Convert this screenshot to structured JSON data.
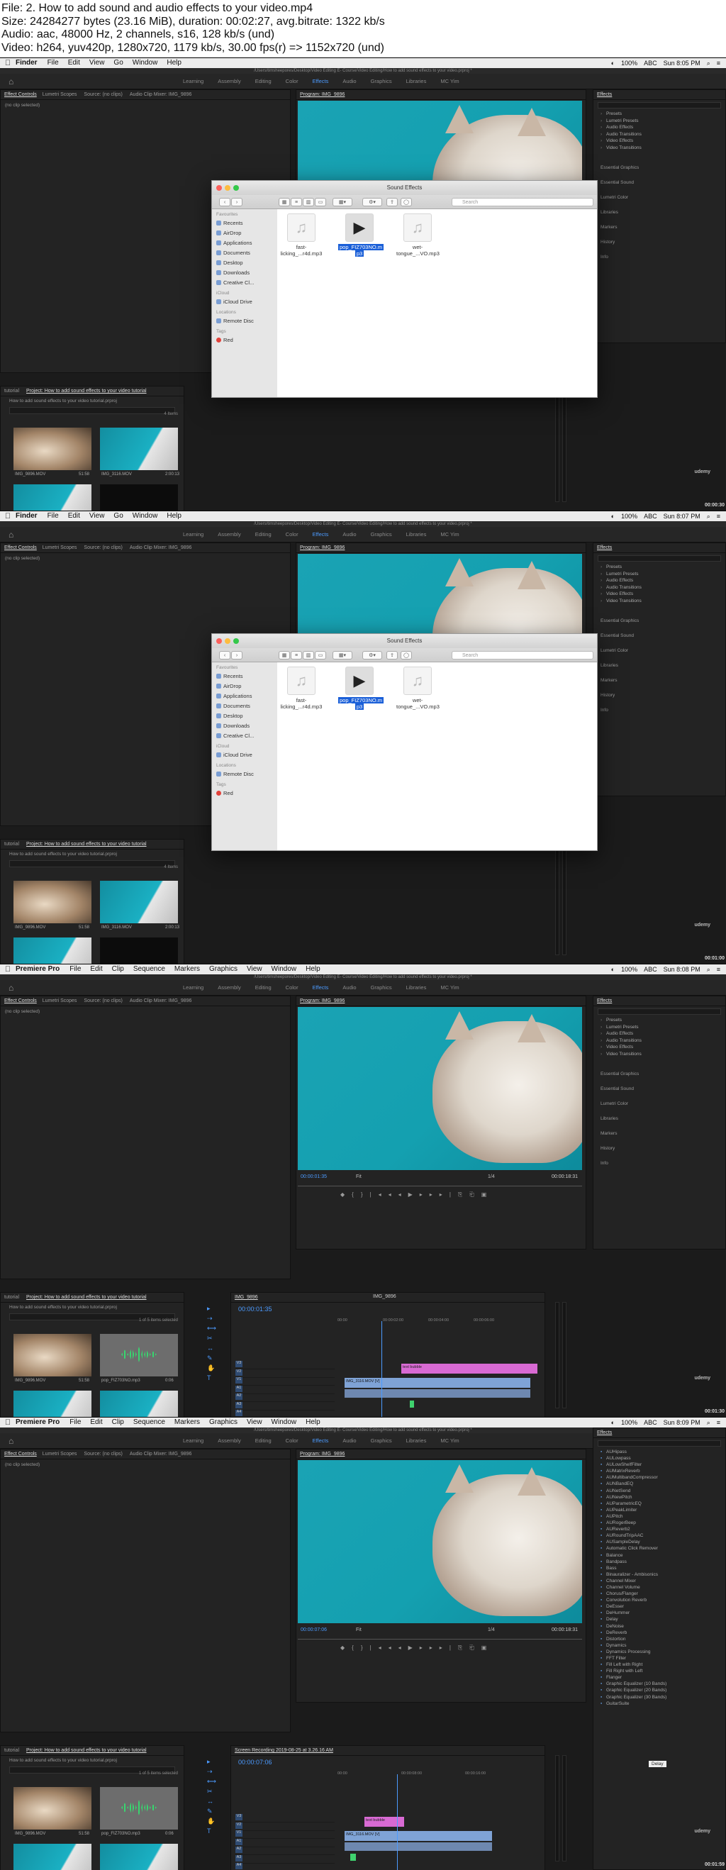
{
  "info": {
    "line1": "File: 2. How to add sound and audio effects to your video.mp4",
    "line2": "Size: 24284277 bytes (23.16 MiB), duration: 00:02:27, avg.bitrate: 1322 kb/s",
    "line3": "Audio: aac, 48000 Hz, 2 channels, s16, 128 kb/s (und)",
    "line4": "Video: h264, yuv420p, 1280x720, 1179 kb/s, 30.00 fps(r) => 1152x720 (und)"
  },
  "path": "/Users/timsheepores/Desktop/Video Editing E- Course/Video Editing/How to add sound effects to your video.prproj *",
  "workspace_tabs": [
    "Learning",
    "Assembly",
    "Editing",
    "Color",
    "Effects",
    "Audio",
    "Graphics",
    "Libraries",
    "MC Yim"
  ],
  "active_tab": "Effects",
  "menubar": {
    "finder_app": "Finder",
    "finder_items": [
      "File",
      "Edit",
      "View",
      "Go",
      "Window",
      "Help"
    ],
    "premiere_app": "Premiere Pro",
    "premiere_items": [
      "File",
      "Edit",
      "Clip",
      "Sequence",
      "Markers",
      "Graphics",
      "View",
      "Window",
      "Help"
    ],
    "status": "100%",
    "abc": "ABC",
    "times": [
      "Sun 8:05 PM",
      "Sun 8:07 PM",
      "Sun 8:08 PM",
      "Sun 8:09 PM"
    ]
  },
  "panels": {
    "effect_controls": "Effect Controls",
    "lumetri_scopes": "Lumetri Scopes",
    "source": "Source: (no clips)",
    "audio_mixer": "Audio Clip Mixer: IMG_9896",
    "no_clip": "(no clip selected)",
    "program": "Program: IMG_9896",
    "effects": "Effects",
    "project_tutorial": "tutorial",
    "project": "Project: How to add sound effects to your video tutorial",
    "project_file": "How to add sound effects to your video tutorial.prproj",
    "items_count": "4 Items",
    "selected_count": "1 of 5 items selected",
    "timeline_tab": "IMG_9896",
    "screen_rec": "Screen Recording 2019-08-25 at 3.26.16 AM"
  },
  "effects_tree": [
    "Presets",
    "Lumetri Presets",
    "Audio Effects",
    "Audio Transitions",
    "Video Effects",
    "Video Transitions"
  ],
  "effects_sections": [
    "Essential Graphics",
    "Essential Sound",
    "Lumetri Color",
    "Libraries",
    "Markers",
    "History",
    "Info"
  ],
  "audio_effects_list": [
    "AUHipass",
    "AULowpass",
    "AULowShelfFilter",
    "AUMatrixReverb",
    "AUMultibandCompressor",
    "AUNBandEQ",
    "AUNetSend",
    "AUNewPitch",
    "AUParametricEQ",
    "AUPeakLimiter",
    "AUPitch",
    "AURogerBeep",
    "AUReverb2",
    "AURoundTripAAC",
    "AUSampleDelay",
    "Automatic Click Remover",
    "Balance",
    "Bandpass",
    "Bass",
    "Binauralizer - Ambisonics",
    "Channel Mixer",
    "Channel Volume",
    "Chorus/Flanger",
    "Convolution Reverb",
    "DeEsser",
    "DeHummer",
    "Delay",
    "DeNoise",
    "DeReverb",
    "Distortion",
    "Dynamics",
    "Dynamics Processing",
    "FFT Filter",
    "Fill Left with Right",
    "Fill Right with Left",
    "Flanger",
    "Graphic Equalizer (10 Bands)",
    "Graphic Equalizer (20 Bands)",
    "Graphic Equalizer (30 Bands)",
    "GuitarSuite"
  ],
  "tooltip": "Delay",
  "finder": {
    "title": "Sound Effects",
    "search": "Search",
    "favourites": "Favourites",
    "fav_items": [
      "Recents",
      "AirDrop",
      "Applications",
      "Documents",
      "Desktop",
      "Downloads",
      "Creative Cl..."
    ],
    "icloud": "iCloud",
    "icloud_items": [
      "iCloud Drive"
    ],
    "locations": "Locations",
    "location_items": [
      "Remote Disc"
    ],
    "tags": "Tags",
    "tag_items": [
      "Red"
    ],
    "files": [
      {
        "name1": "fast-",
        "name2": "licking_...r4d.mp3"
      },
      {
        "name1": "pop_FIZ703NO.m",
        "name2": "p3"
      },
      {
        "name1": "wet-",
        "name2": "tongue_...VO.mp3"
      }
    ]
  },
  "thumbs": {
    "img9896": "IMG_9896.MOV",
    "img9896_dur": "51:58",
    "img3116": "IMG_3116.MOV",
    "img3116_dur": "2:00:13",
    "pop": "pop_FIZ703NO.mp3",
    "pop_dur": "0:06"
  },
  "program_ctrl": {
    "fit": "Fit",
    "frac": "1/4",
    "tc_end": "00:00:18:31",
    "tc_a": "00:00:01:35",
    "tc_b": "00:00:07:06"
  },
  "timeline": {
    "tc_a": "00:00:01:35",
    "tc_b": "00:00:07:06",
    "ruler_a": [
      "00:00",
      "00:00:02:00",
      "00:00:04:00",
      "00:00:06:00"
    ],
    "ruler_b": [
      "00:00",
      "00:00:08:00",
      "00:00:16:00"
    ],
    "tracks": [
      "V3",
      "V2",
      "V1",
      "A1",
      "A2",
      "A3",
      "A4"
    ],
    "master": "Master",
    "text_clip": "text bubble",
    "video_clip": "IMG_3116.MOV [V]"
  },
  "stamps": [
    "00:00:30",
    "00:01:00",
    "00:01:30",
    "00:01:59"
  ],
  "udemy": "udemy"
}
